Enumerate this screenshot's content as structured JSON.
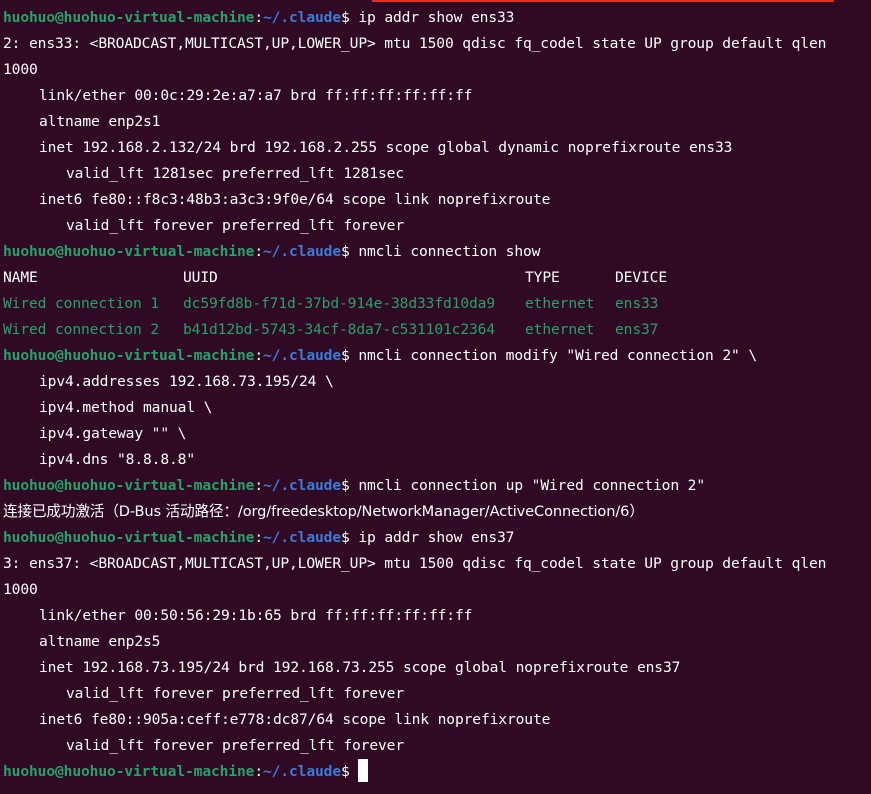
{
  "prompt": {
    "user_host": "huohuo@huohuo-virtual-machine",
    "path": "~/.claude",
    "sign": "$"
  },
  "lines": {
    "cmd1": "ip addr show ens33",
    "l1": "2: ens33: <BROADCAST,MULTICAST,UP,LOWER_UP> mtu 1500 qdisc fq_codel state UP group default qlen",
    "l2": "1000",
    "l3": "link/ether 00:0c:29:2e:a7:a7 brd ff:ff:ff:ff:ff:ff",
    "l4": "altname enp2s1",
    "l5": "inet 192.168.2.132/24 brd 192.168.2.255 scope global dynamic noprefixroute ens33",
    "l6": "valid_lft 1281sec preferred_lft 1281sec",
    "l7": "inet6 fe80::f8c3:48b3:a3c3:9f0e/64 scope link noprefixroute",
    "l8": "valid_lft forever preferred_lft forever",
    "cmd2": "nmcli connection show",
    "cmd3": "nmcli connection modify \"Wired connection 2\" \\",
    "c3a": "ipv4.addresses 192.168.73.195/24 \\",
    "c3b": "ipv4.method manual \\",
    "c3c": "ipv4.gateway \"\" \\",
    "c3d": "ipv4.dns \"8.8.8.8\"",
    "cmd4": "nmcli connection up \"Wired connection 2\"",
    "result4": "连接已成功激活（D-Bus 活动路径：/org/freedesktop/NetworkManager/ActiveConnection/6）",
    "cmd5": "ip addr show ens37",
    "m1": "3: ens37: <BROADCAST,MULTICAST,UP,LOWER_UP> mtu 1500 qdisc fq_codel state UP group default qlen",
    "m2": "1000",
    "m3": "link/ether 00:50:56:29:1b:65 brd ff:ff:ff:ff:ff:ff",
    "m4": "altname enp2s5",
    "m5": "inet 192.168.73.195/24 brd 192.168.73.255 scope global noprefixroute ens37",
    "m6": "valid_lft forever preferred_lft forever",
    "m7": "inet6 fe80::905a:ceff:e778:dc87/64 scope link noprefixroute",
    "m8": "valid_lft forever preferred_lft forever"
  },
  "connections": {
    "headers": [
      "NAME",
      "UUID",
      "TYPE",
      "DEVICE"
    ],
    "rows": [
      [
        "Wired connection 1",
        "dc59fd8b-f71d-37bd-914e-38d33fd10da9",
        "ethernet",
        "ens33"
      ],
      [
        "Wired connection 2",
        "b41d12bd-5743-34cf-8da7-c531101c2364",
        "ethernet",
        "ens37"
      ]
    ]
  },
  "colors": {
    "background": "#300a24",
    "prompt_user": "#26a269",
    "prompt_path": "#3b7bd9",
    "text": "#ffffff",
    "active_connection": "#26a269"
  }
}
